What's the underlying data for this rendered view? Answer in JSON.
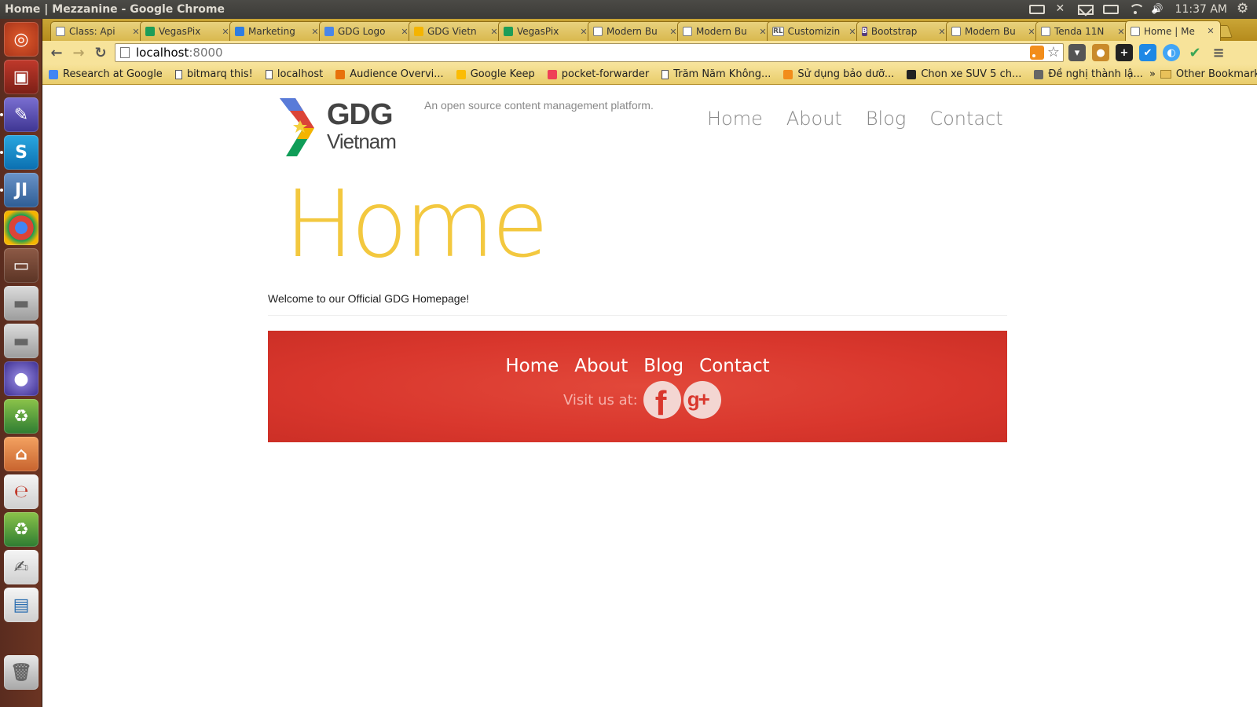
{
  "os": {
    "window_title": "Home | Mezzanine - Google Chrome",
    "clock": "11:37 AM"
  },
  "browser": {
    "tabs": [
      {
        "title": "Class: Api",
        "favicon_color": "#ffffff",
        "active": false
      },
      {
        "title": "VegasPix",
        "favicon_color": "#1e9d58",
        "active": false
      },
      {
        "title": "Marketing",
        "favicon_color": "#2f7de1",
        "active": false
      },
      {
        "title": "GDG Logo",
        "favicon_color": "#4a86e8",
        "active": false
      },
      {
        "title": "GDG Vietn",
        "favicon_color": "#f4b400",
        "active": false
      },
      {
        "title": "VegasPix",
        "favicon_color": "#1e9d58",
        "active": false
      },
      {
        "title": "Modern Bu",
        "favicon_color": "#ffffff",
        "active": false
      },
      {
        "title": "Modern Bu",
        "favicon_color": "#ffffff",
        "active": false
      },
      {
        "title": "Customizin",
        "favicon_color": "#ffffff",
        "active": false,
        "favicon_text": "RL"
      },
      {
        "title": "Bootstrap",
        "favicon_color": "#563d7c",
        "active": false,
        "favicon_text": "B"
      },
      {
        "title": "Modern Bu",
        "favicon_color": "#ffffff",
        "active": false
      },
      {
        "title": "Tenda 11N",
        "favicon_color": "#ffffff",
        "active": false
      },
      {
        "title": "Home | Me",
        "favicon_color": "#ffffff",
        "active": true
      }
    ],
    "url_host": "localhost",
    "url_port": ":8000",
    "bookmarks": [
      {
        "label": "Research at Google",
        "icon_color": "#4285f4"
      },
      {
        "label": "bitmarq this!",
        "icon_color": "page"
      },
      {
        "label": "localhost",
        "icon_color": "page"
      },
      {
        "label": "Audience Overvi...",
        "icon_color": "#e8710a"
      },
      {
        "label": "Google Keep",
        "icon_color": "#fbbc04"
      },
      {
        "label": "pocket-forwarder",
        "icon_color": "#ef4056"
      },
      {
        "label": "Trăm Năm Không...",
        "icon_color": "page"
      },
      {
        "label": "Sử dụng bảo dưỡ...",
        "icon_color": "#f28d1b"
      },
      {
        "label": "Chon xe SUV 5 ch...",
        "icon_color": "#222222"
      },
      {
        "label": "Đề nghị thành lậ...",
        "icon_color": "#666666"
      }
    ],
    "bookmarks_more": "»",
    "other_bookmarks": "Other Bookmarks"
  },
  "site": {
    "logo_gdg": "GDG",
    "logo_vietnam": "Vietnam",
    "tagline": "An open source content management platform.",
    "nav": [
      "Home",
      "About",
      "Blog",
      "Contact"
    ],
    "heading": "Home",
    "welcome": "Welcome to our Official GDG Homepage!",
    "footer_nav": [
      "Home",
      "About",
      "Blog",
      "Contact"
    ],
    "visit_label": "Visit us at:",
    "accent_color": "#f2c32b",
    "footer_color": "#d9372d"
  }
}
